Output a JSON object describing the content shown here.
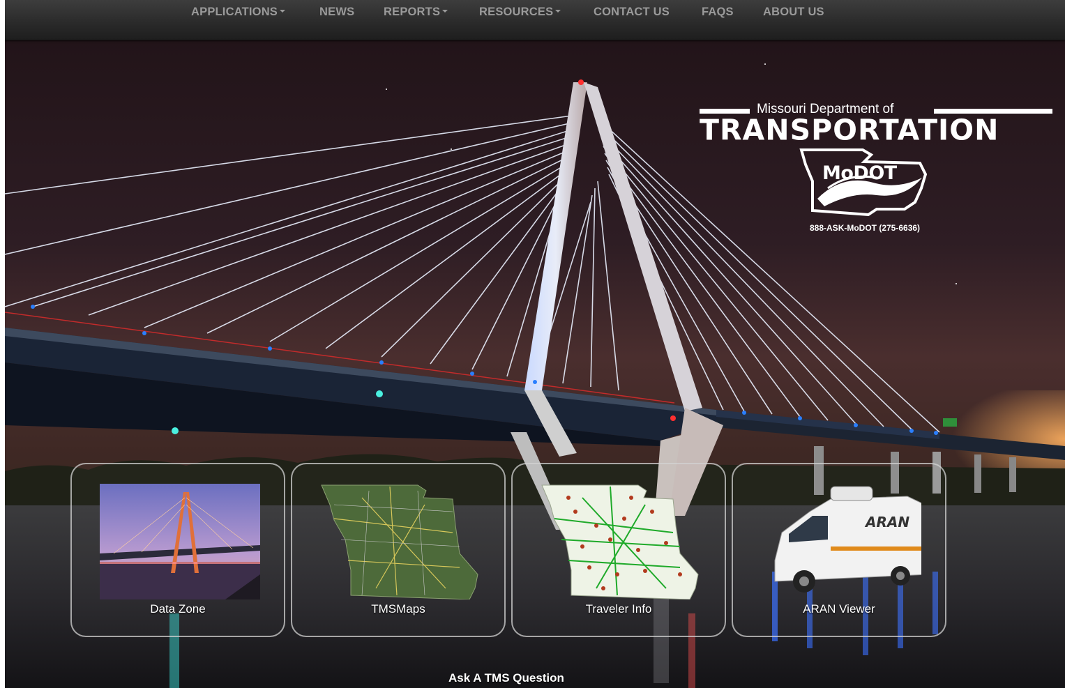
{
  "navbar": {
    "items": [
      {
        "label": "APPLICATIONS",
        "dropdown": true
      },
      {
        "label": "NEWS",
        "dropdown": false
      },
      {
        "label": "REPORTS",
        "dropdown": true
      },
      {
        "label": "RESOURCES",
        "dropdown": true
      },
      {
        "label": "CONTACT US",
        "dropdown": false
      },
      {
        "label": "FAQS",
        "dropdown": false
      },
      {
        "label": "ABOUT US",
        "dropdown": false
      }
    ]
  },
  "logo": {
    "subtitle": "Missouri Department of",
    "title": "TRANSPORTATION",
    "mark": "MoDOT",
    "phone": "888-ASK-MoDOT (275-6636)"
  },
  "tiles": [
    {
      "label": "Data Zone",
      "icon": "bridge-photo"
    },
    {
      "label": "TMSMaps",
      "icon": "missouri-satellite-map"
    },
    {
      "label": "Traveler Info",
      "icon": "missouri-traffic-map"
    },
    {
      "label": "ARAN Viewer",
      "icon": "aran-van"
    }
  ],
  "footer": {
    "ask_link": "Ask A TMS Question"
  },
  "colors": {
    "nav_text": "#9a9a9a",
    "night_sky": "#2a1d22",
    "cable_light": "#e8eefc",
    "deck_accent": "#2a7fff"
  }
}
